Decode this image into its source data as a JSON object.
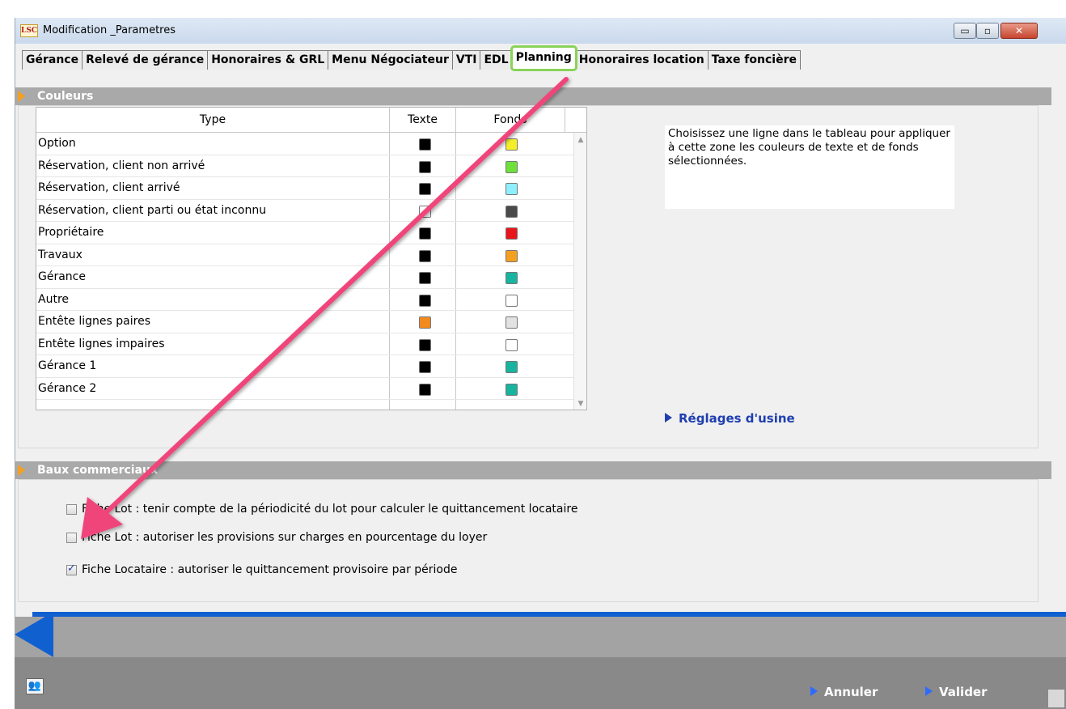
{
  "window": {
    "title": "Modification _Parametres",
    "logo_text": "LSC"
  },
  "window_controls": {
    "minimize": "▭",
    "maximize": "▫",
    "close": "✕"
  },
  "tabs": [
    {
      "label": "Gérance",
      "active": false
    },
    {
      "label": "Relevé de gérance",
      "active": false
    },
    {
      "label": "Honoraires & GRL",
      "active": false
    },
    {
      "label": "Menu Négociateur",
      "active": false
    },
    {
      "label": "VTI",
      "active": false
    },
    {
      "label": "EDL",
      "active": false
    },
    {
      "label": "Planning",
      "active": true
    },
    {
      "label": "Honoraires location",
      "active": false
    },
    {
      "label": "Taxe foncière",
      "active": false
    }
  ],
  "couleurs": {
    "section_title": "Couleurs",
    "columns": {
      "type": "Type",
      "texte": "Texte",
      "fonds": "Fonds"
    },
    "rows": [
      {
        "type": "Option",
        "texte": "#000000",
        "fonds": "#f5ef2a"
      },
      {
        "type": "Réservation, client non arrivé",
        "texte": "#000000",
        "fonds": "#6fe03a"
      },
      {
        "type": "Réservation, client arrivé",
        "texte": "#000000",
        "fonds": "#8ef0ff"
      },
      {
        "type": "Réservation, client parti ou état inconnu",
        "texte": "#ffffff",
        "fonds": "#4a4a4a"
      },
      {
        "type": "Propriétaire",
        "texte": "#000000",
        "fonds": "#e8161b"
      },
      {
        "type": "Travaux",
        "texte": "#000000",
        "fonds": "#f5a020"
      },
      {
        "type": "Gérance",
        "texte": "#000000",
        "fonds": "#18b4a0"
      },
      {
        "type": "Autre",
        "texte": "#000000",
        "fonds": "#ffffff"
      },
      {
        "type": "Entête lignes paires",
        "texte": "#f28a1e",
        "fonds": "#e2e2e2"
      },
      {
        "type": "Entête lignes impaires",
        "texte": "#000000",
        "fonds": "#ffffff"
      },
      {
        "type": "Gérance 1",
        "texte": "#000000",
        "fonds": "#18b4a0"
      },
      {
        "type": "Gérance 2",
        "texte": "#000000",
        "fonds": "#18b4a0"
      }
    ],
    "hint": "Choisissez une ligne dans le tableau pour appliquer à cette zone les couleurs de texte et de fonds sélectionnées.",
    "reset_link": "Réglages d'usine"
  },
  "baux": {
    "section_title": "Baux commerciaux",
    "options": [
      {
        "label": "Fiche Lot : tenir compte de la périodicité du lot pour calculer le quittancement locataire",
        "checked": false
      },
      {
        "label": "Fiche Lot : autoriser les provisions sur charges en pourcentage du loyer",
        "checked": false
      },
      {
        "label": "Fiche Locataire : autoriser le quittancement provisoire par période",
        "checked": true
      }
    ]
  },
  "footer": {
    "cancel": "Annuler",
    "validate": "Valider"
  },
  "icons": {
    "users": "users-icon",
    "chevron": "chevron-right-icon"
  },
  "accent_colors": {
    "section_chevron": "#f5a020",
    "link": "#1f3fb0",
    "active_tab_outline": "#8ad25a",
    "annotation_arrow": "#f0457a"
  }
}
